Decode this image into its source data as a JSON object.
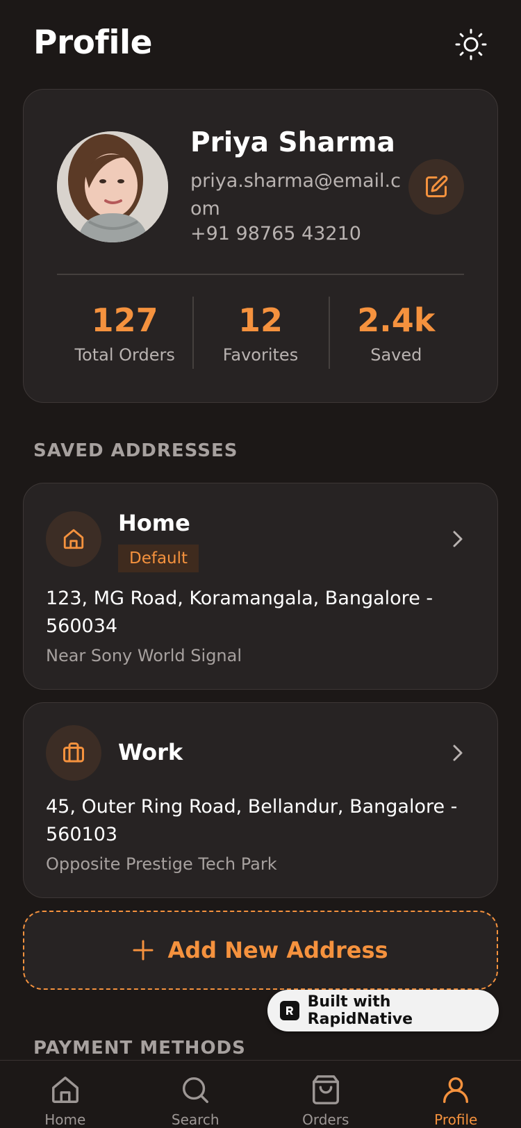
{
  "header": {
    "title": "Profile"
  },
  "profile": {
    "name": "Priya Sharma",
    "email": "priya.sharma@email.com",
    "phone": "+91 98765 43210",
    "stats": [
      {
        "value": "127",
        "label": "Total Orders"
      },
      {
        "value": "12",
        "label": "Favorites"
      },
      {
        "value": "2.4k",
        "label": "Saved"
      }
    ]
  },
  "addresses": {
    "section_title": "SAVED ADDRESSES",
    "items": [
      {
        "title": "Home",
        "badge": "Default",
        "address": "123, MG Road, Koramangala, Bangalore - 560034",
        "landmark": "Near Sony World Signal",
        "icon": "home-icon"
      },
      {
        "title": "Work",
        "address": "45, Outer Ring Road, Bellandur, Bangalore - 560103",
        "landmark": "Opposite Prestige Tech Park",
        "icon": "briefcase-icon"
      }
    ],
    "add_label": "Add New Address"
  },
  "payment": {
    "section_title": "PAYMENT METHODS"
  },
  "built_badge": "Built with RapidNative",
  "nav": {
    "items": [
      {
        "label": "Home",
        "icon": "home-icon"
      },
      {
        "label": "Search",
        "icon": "search-icon"
      },
      {
        "label": "Orders",
        "icon": "shopping-bag-icon"
      },
      {
        "label": "Profile",
        "icon": "user-icon",
        "active": true
      }
    ]
  },
  "colors": {
    "accent": "#f5923e",
    "background": "#1c1817",
    "card": "#272323"
  }
}
